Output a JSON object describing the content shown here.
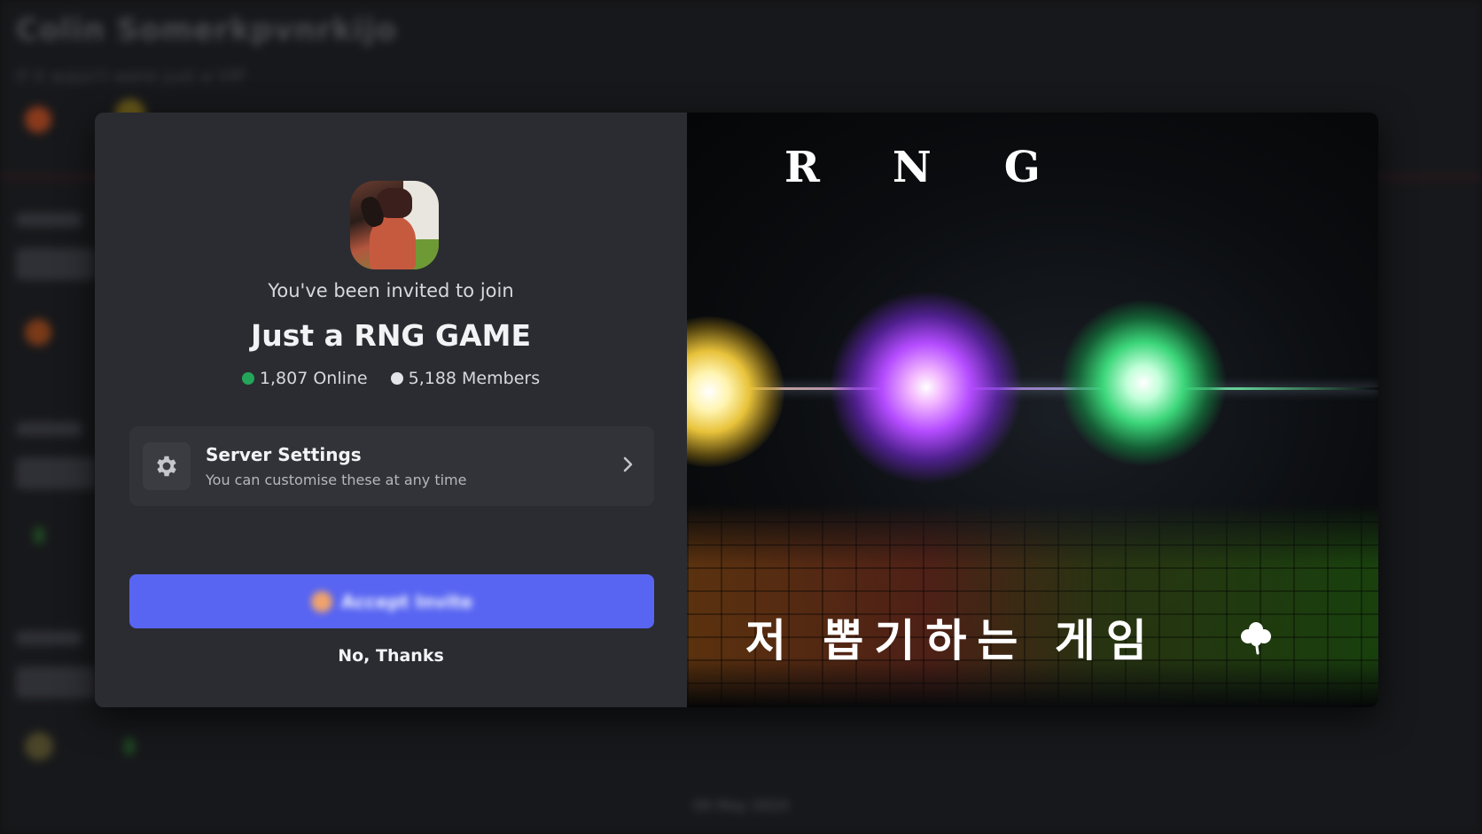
{
  "background": {
    "channel_title": "Colin Somerkpvnrkijo",
    "channel_subtitle": "If it wasn't were just a VIP",
    "date_divider": "09 May 2024"
  },
  "invite": {
    "invited_text": "You've been invited to join",
    "server_name": "Just a RNG GAME",
    "online_count": "1,807 Online",
    "member_count": "5,188 Members",
    "online_dot_color": "#23a55a",
    "member_dot_color": "#e3e5e8"
  },
  "settings_row": {
    "icon": "gear-icon",
    "title": "Server Settings",
    "description": "You can customise these at any time",
    "chevron": "chevron-right-icon"
  },
  "accept_button": {
    "label": "Accept Invite",
    "color": "#5865f2"
  },
  "decline_link": {
    "label": "No, Thanks"
  },
  "banner": {
    "letters": [
      "R",
      "N",
      "G"
    ],
    "tagline": "저 뽑기하는 게임",
    "tagline_icon": "clover-icon"
  }
}
